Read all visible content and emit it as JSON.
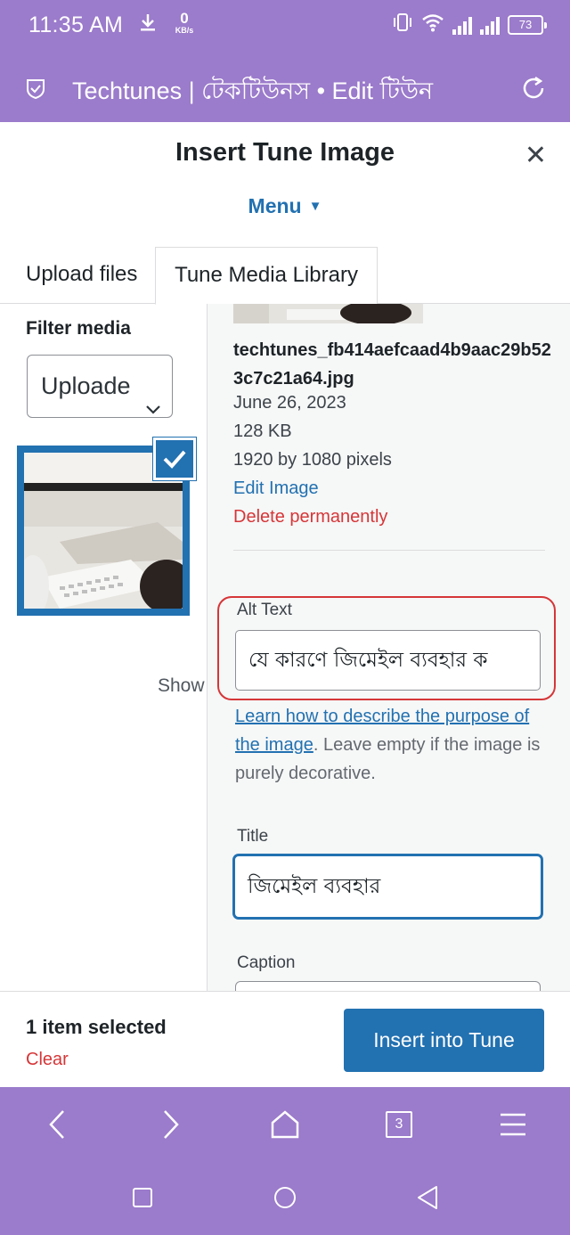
{
  "status_bar": {
    "time": "11:35 AM",
    "net_speed": "0",
    "net_unit": "KB/s",
    "battery": "73"
  },
  "browser": {
    "page_title": "Techtunes | টেকটিউনস • Edit টিউন",
    "tab_count": "3"
  },
  "modal": {
    "title": "Insert Tune Image",
    "menu_label": "Menu",
    "tabs": [
      "Upload files",
      "Tune Media Library"
    ]
  },
  "sidebar": {
    "filter_label": "Filter media",
    "filter_value": "Uploade",
    "show_text": "Show"
  },
  "details": {
    "filename": "techtunes_fb414aefcaad4b9aac29b523c7c21a64.jpg",
    "date": "June 26, 2023",
    "size": "128 KB",
    "dimensions": "1920 by 1080 pixels",
    "edit_link": "Edit Image",
    "delete_link": "Delete permanently",
    "alt_label": "Alt Text",
    "alt_value": "যে কারণে জিমেইল ব্যবহার ক",
    "help_link": "Learn how to describe the purpose of the image",
    "help_rest": ". Leave empty if the image is purely decorative.",
    "title_label": "Title",
    "title_value": "জিমেইল ব্যবহার",
    "caption_label": "Caption"
  },
  "footer": {
    "selected": "1 item selected",
    "clear": "Clear",
    "insert": "Insert into Tune"
  },
  "colors": {
    "brand_purple": "#9b7bcb",
    "accent_blue": "#2271b1",
    "danger_red": "#d63638"
  }
}
